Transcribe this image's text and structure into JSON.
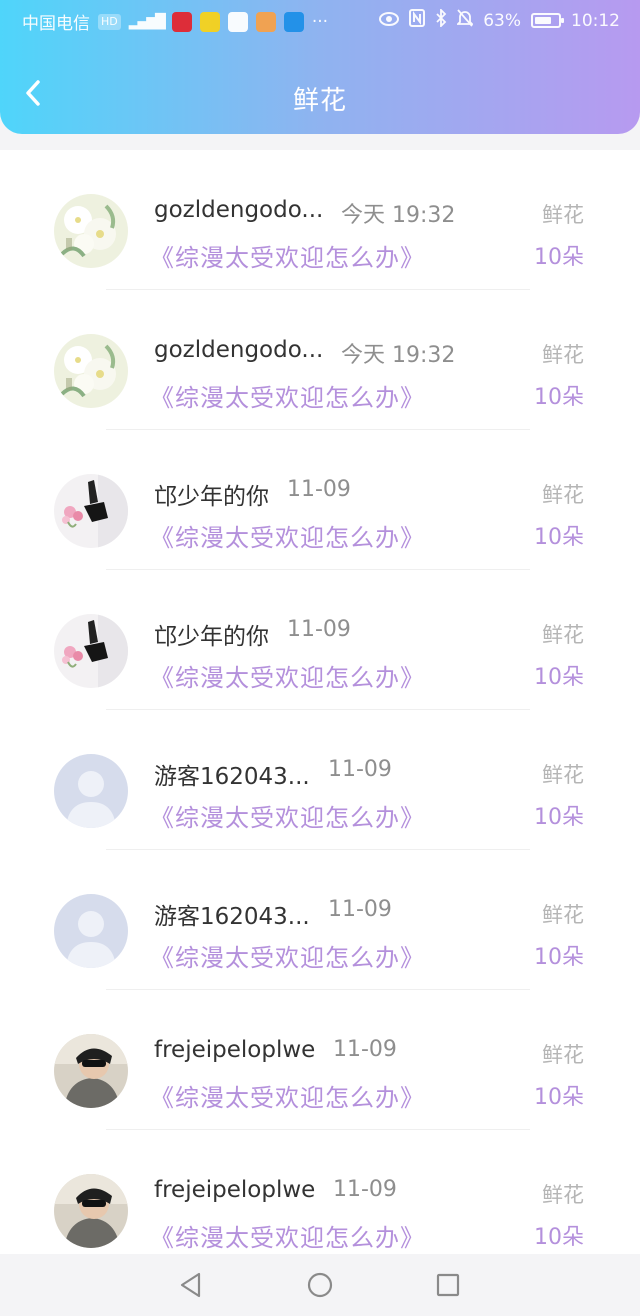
{
  "status_bar": {
    "carrier": "中国电信",
    "hd_badge": "HD",
    "network": "4G",
    "battery_percent": "63%",
    "time": "10:12",
    "overflow": "···"
  },
  "header": {
    "title": "鲜花"
  },
  "gift_list": [
    {
      "user": "gozldengodo...",
      "time": "今天 19:32",
      "book": "《综漫太受欢迎怎么办》",
      "gift_type": "鲜花",
      "count": "10朵",
      "avatar": "flowers-avatar"
    },
    {
      "user": "gozldengodo...",
      "time": "今天 19:32",
      "book": "《综漫太受欢迎怎么办》",
      "gift_type": "鲜花",
      "count": "10朵",
      "avatar": "flowers-avatar"
    },
    {
      "user": "邙少年的你",
      "time": "11-09",
      "book": "《综漫太受欢迎怎么办》",
      "gift_type": "鲜花",
      "count": "10朵",
      "avatar": "bag-avatar"
    },
    {
      "user": "邙少年的你",
      "time": "11-09",
      "book": "《综漫太受欢迎怎么办》",
      "gift_type": "鲜花",
      "count": "10朵",
      "avatar": "bag-avatar"
    },
    {
      "user": "游客162043...",
      "time": "11-09",
      "book": "《综漫太受欢迎怎么办》",
      "gift_type": "鲜花",
      "count": "10朵",
      "avatar": "default-avatar"
    },
    {
      "user": "游客162043...",
      "time": "11-09",
      "book": "《综漫太受欢迎怎么办》",
      "gift_type": "鲜花",
      "count": "10朵",
      "avatar": "default-avatar"
    },
    {
      "user": "frejeipeloplwe",
      "time": "11-09",
      "book": "《综漫太受欢迎怎么办》",
      "gift_type": "鲜花",
      "count": "10朵",
      "avatar": "person-avatar"
    },
    {
      "user": "frejeipeloplwe",
      "time": "11-09",
      "book": "《综漫太受欢迎怎么办》",
      "gift_type": "鲜花",
      "count": "10朵",
      "avatar": "person-avatar"
    }
  ],
  "nav": {
    "back_icon": "triangle-back-icon",
    "home_icon": "circle-home-icon",
    "recents_icon": "square-recents-icon"
  },
  "colors": {
    "header_gradient_start": "#4fd5fa",
    "header_gradient_end": "#b79af0",
    "accent_purple": "#b490dc"
  }
}
